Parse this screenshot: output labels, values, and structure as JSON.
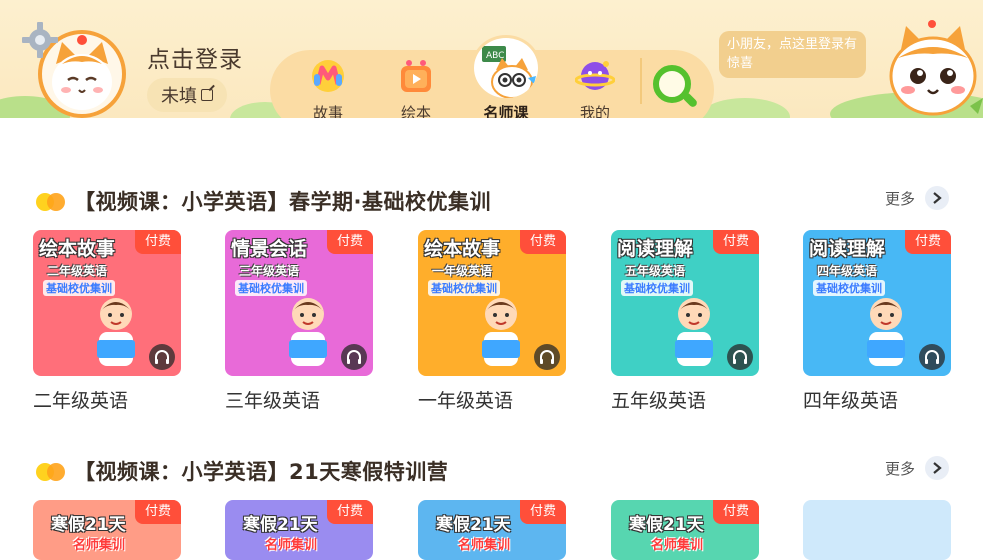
{
  "header": {
    "login_text": "点击登录",
    "unfilled_label": "未填",
    "bubble_text": "小朋友，点这里登录有惊喜",
    "nav": [
      {
        "label": "故事",
        "icon": "story-icon"
      },
      {
        "label": "绘本",
        "icon": "picture-book-icon"
      },
      {
        "label": "名师课",
        "icon": "teacher-course-icon",
        "active": true
      },
      {
        "label": "我的",
        "icon": "profile-planet-icon"
      }
    ],
    "search_icon": "search-icon"
  },
  "sections": [
    {
      "title": "【视频课：小学英语】春学期·基础校优集训",
      "more": "更多",
      "cards": [
        {
          "label": "二年级英语",
          "badge": "付费",
          "cover_title": "绘本故事",
          "cover_sub": "二年级英语",
          "cover_sub2": "基础校优集训",
          "color": "#ff6f7a"
        },
        {
          "label": "三年级英语",
          "badge": "付费",
          "cover_title": "情景会话",
          "cover_sub": "三年级英语",
          "cover_sub2": "基础校优集训",
          "color": "#e86ad8"
        },
        {
          "label": "一年级英语",
          "badge": "付费",
          "cover_title": "绘本故事",
          "cover_sub": "一年级英语",
          "cover_sub2": "基础校优集训",
          "color": "#ffae2b"
        },
        {
          "label": "五年级英语",
          "badge": "付费",
          "cover_title": "阅读理解",
          "cover_sub": "五年级英语",
          "cover_sub2": "基础校优集训",
          "color": "#3fd0c5"
        },
        {
          "label": "四年级英语",
          "badge": "付费",
          "cover_title": "阅读理解",
          "cover_sub": "四年级英语",
          "cover_sub2": "基础校优集训",
          "color": "#48b8f5"
        }
      ]
    },
    {
      "title": "【视频课：小学英语】21天寒假特训营",
      "more": "更多",
      "cards": [
        {
          "badge": "付费",
          "cover_title": "寒假21天",
          "cover_sub": "名师集训",
          "color": "#ff9c86"
        },
        {
          "badge": "付费",
          "cover_title": "寒假21天",
          "cover_sub": "名师集训",
          "color": "#9a8cf0"
        },
        {
          "badge": "付费",
          "cover_title": "寒假21天",
          "cover_sub": "名师集训",
          "color": "#5db6f0"
        },
        {
          "badge": "付费",
          "cover_title": "寒假21天",
          "cover_sub": "名师集训",
          "color": "#57d6b0"
        },
        {
          "badge": "",
          "cover_title": "",
          "cover_sub": "",
          "color": "#cfe9fb"
        }
      ]
    }
  ]
}
